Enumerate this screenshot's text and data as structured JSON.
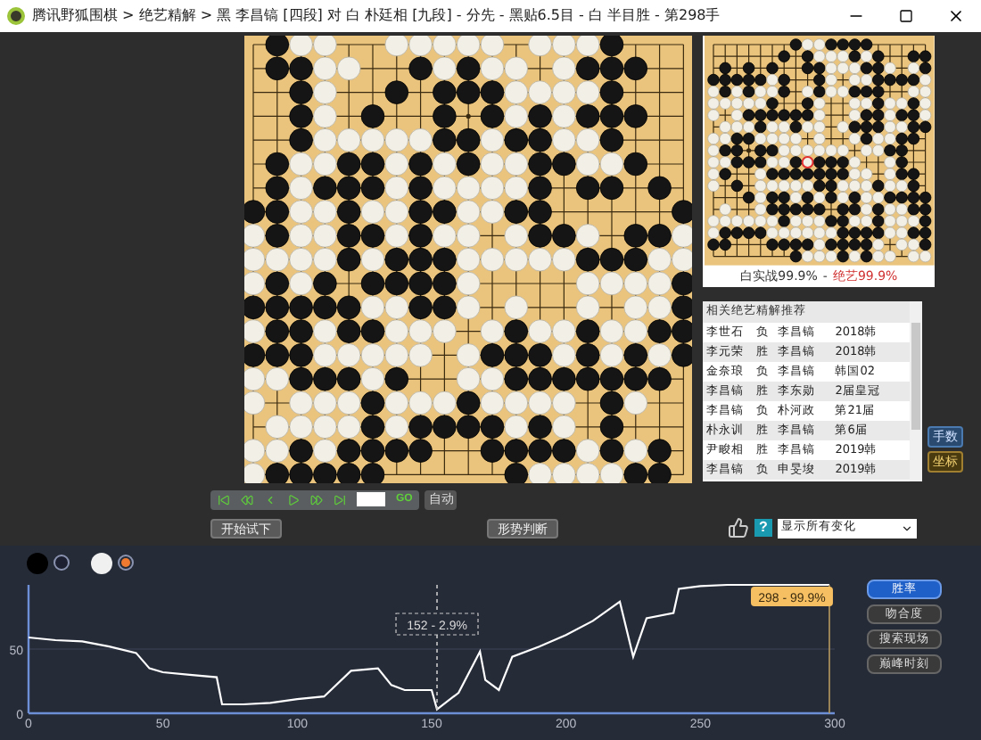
{
  "window": {
    "title": "腾讯野狐围棋 > 绝艺精解 > 黑 李昌镐 [四段] 对 白 朴廷相 [九段] - 分先 - 黑贴6.5目 - 白 半目胜 - 第298手"
  },
  "mini_board": {
    "caption_left": "白实战99.9%",
    "caption_separator": "-",
    "caption_right": "绝艺99.9%"
  },
  "recommend_table": {
    "title": "相关绝艺精解推荐",
    "rows": [
      {
        "cells": [
          "李世石",
          "负",
          "李昌镐",
          "2018韩"
        ]
      },
      {
        "cells": [
          "李元荣",
          "胜",
          "李昌镐",
          "2018韩"
        ]
      },
      {
        "cells": [
          "金奈琅",
          "负",
          "李昌镐",
          "韩国02"
        ]
      },
      {
        "cells": [
          "李昌镐",
          "胜",
          "李东勋",
          "2届皇冠"
        ]
      },
      {
        "cells": [
          "李昌镐",
          "负",
          "朴河政",
          "第21届"
        ]
      },
      {
        "cells": [
          "朴永训",
          "胜",
          "李昌镐",
          "第6届"
        ]
      },
      {
        "cells": [
          "尹畯相",
          "胜",
          "李昌镐",
          "2019韩"
        ]
      },
      {
        "cells": [
          "李昌镐",
          "负",
          "申旻埈",
          "2019韩"
        ]
      }
    ]
  },
  "side_buttons": [
    {
      "label": "手数",
      "kind": "blue"
    },
    {
      "label": "坐标",
      "kind": "gold"
    }
  ],
  "playback": {
    "go": "GO",
    "auto": "自动"
  },
  "actions": {
    "try_button": "开始试下",
    "judge_button": "形势判断",
    "help": "?",
    "variation_select": "显示所有变化"
  },
  "chart_tabs": [
    {
      "label": "胜率",
      "selected": true
    },
    {
      "label": "吻合度",
      "selected": false
    },
    {
      "label": "搜索现场",
      "selected": false
    },
    {
      "label": "巅峰时刻",
      "selected": false
    }
  ],
  "hover_label": "152 - 2.9%",
  "end_label": "298 - 99.9%",
  "chart_data": {
    "type": "line",
    "x": [
      0,
      10,
      20,
      30,
      40,
      45,
      50,
      60,
      70,
      72,
      80,
      90,
      100,
      110,
      120,
      130,
      135,
      140,
      150,
      152,
      160,
      168,
      170,
      175,
      180,
      190,
      200,
      210,
      220,
      225,
      230,
      240,
      242,
      250,
      260,
      270,
      280,
      290,
      298
    ],
    "series": [
      {
        "color": "#ffffff",
        "values": [
          59,
          57,
          56,
          52,
          47,
          35,
          32,
          30,
          28,
          7,
          7,
          8,
          11,
          13,
          33,
          35,
          22,
          18,
          18,
          3,
          16,
          48,
          26,
          18,
          44,
          52,
          61,
          72,
          87,
          44,
          74,
          78,
          97,
          99,
          100,
          100,
          100,
          100,
          100
        ]
      }
    ],
    "ref_lines": [
      {
        "axis": "x",
        "value": 152,
        "color": "#c8c8c8"
      },
      {
        "axis": "x",
        "value": 298,
        "color": "#b89a60"
      }
    ],
    "xlim": [
      0,
      300
    ],
    "ylim": [
      0,
      100
    ],
    "xticks": [
      0,
      50,
      100,
      150,
      200,
      250,
      300
    ],
    "yticks": [
      0,
      50
    ]
  }
}
